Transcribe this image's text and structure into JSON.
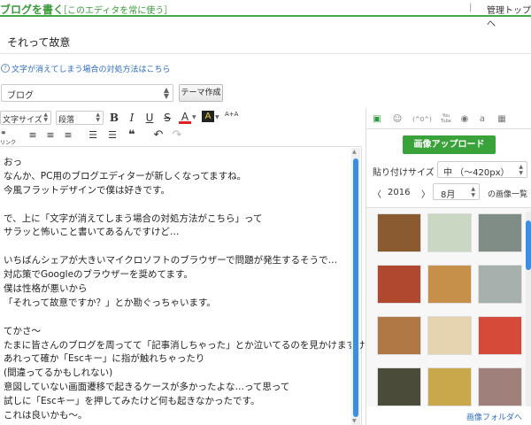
{
  "header": {
    "title": "ブログを書く",
    "subtitle": "［このエディタを常に使う］",
    "separator": "|",
    "admin_link": "管理トップへ"
  },
  "post": {
    "title": "それって故意"
  },
  "notice": {
    "icon": "question-icon",
    "text": "文字が消えてしまう場合の対処方法はこちら"
  },
  "category": {
    "selected": "ブログ",
    "theme_button": "テーマ作成"
  },
  "toolbar": {
    "font_size": "文字サイズ",
    "paragraph": "段落",
    "bold": "B",
    "italic": "I",
    "underline": "U",
    "strike": "S",
    "text_color": "A",
    "bg_color": "A",
    "aa": "A+A",
    "link": "リンク",
    "icons": [
      "link-icon",
      "align-left-icon",
      "align-center-icon",
      "align-right-icon",
      "bullet-list-icon",
      "numbered-list-icon",
      "quote-icon",
      "undo-icon",
      "redo-icon"
    ]
  },
  "editor": {
    "lines": [
      "おっ",
      "なんか、PC用のブログエディターが新しくなってますね。",
      "今風フラットデザインで僕は好きです。",
      "",
      "で、上に「文字が消えてしまう場合の対処方法がこちら」って",
      "サラッと怖いこと書いてあるんですけど…",
      "",
      "いちばんシェアが大きいマイクロソフトのブラウザーで問題が発生するそうで…",
      "対応策でGoogleのブラウザーを奨めてます。",
      "僕は性格が悪いから",
      "「それって故意ですか？」とか勘ぐっちゃいます。",
      "",
      "てかさ〜",
      "たまに皆さんのブログを周ってて「記事消しちゃった」とか泣いてるのを見かけますけど、",
      "あれって確か「Escキー」に指が触れちゃったり",
      "(間違ってるかもしれない)",
      "意図していない画面遷移で起きるケースが多かったよな…って思って",
      "試しに「Escキー」を押してみたけど何も起きなかったです。",
      "これは良いかも〜。"
    ]
  },
  "panel": {
    "tab_icons": [
      "image-icon",
      "emoji-icon",
      "kaomoji-icon",
      "youtube-icon",
      "photo-icon",
      "amazon-icon",
      "table-icon"
    ],
    "kaomoji_label": "(^0^)",
    "youtube_label": "You Tube",
    "amazon_label": "a",
    "upload_button": "画像アップロード",
    "paste_size_label": "貼り付けサイズ",
    "paste_size_value": "中 （〜420px）",
    "prev_year": "〈",
    "year": "2016",
    "next_year": "〉",
    "month": "8月",
    "image_list_label": "の画像一覧",
    "folder_link": "画像フォルダへ",
    "thumbnails": [
      {
        "name": "grilled-fish",
        "color": "#8a5a30"
      },
      {
        "name": "map",
        "color": "#c9d7c3"
      },
      {
        "name": "road",
        "color": "#7f8d86"
      },
      {
        "name": "food-tray",
        "color": "#b04830"
      },
      {
        "name": "fish-pieces",
        "color": "#c7904a"
      },
      {
        "name": "parking",
        "color": "#a8b0ae"
      },
      {
        "name": "roll-cakes",
        "color": "#b07844"
      },
      {
        "name": "flyer",
        "color": "#e6d3b0"
      },
      {
        "name": "watermelon",
        "color": "#d64a3a"
      },
      {
        "name": "yellow-plate",
        "color": "#4b4b3a"
      },
      {
        "name": "drinks",
        "color": "#c8a84a"
      },
      {
        "name": "shop",
        "color": "#a0807a"
      }
    ]
  }
}
